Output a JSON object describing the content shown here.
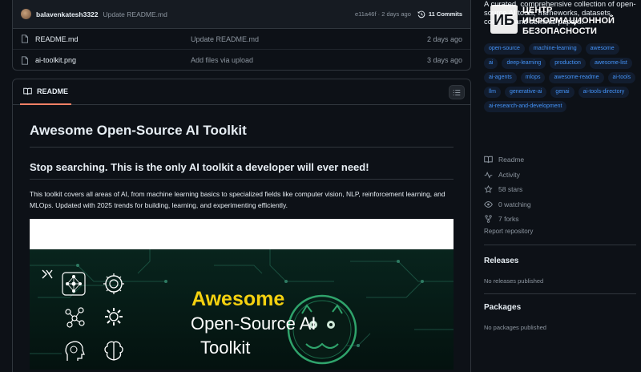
{
  "commit": {
    "user": "balavenkatesh3322",
    "message": "Update README.md",
    "hash_time": "e11a46f · 2 days ago",
    "commits_label": "11 Commits"
  },
  "files": [
    {
      "name": "README.md",
      "message": "Update README.md",
      "date": "2 days ago"
    },
    {
      "name": "ai-toolkit.png",
      "message": "Add files via upload",
      "date": "3 days ago"
    }
  ],
  "readme": {
    "tab_label": "README",
    "h1": "Awesome Open-Source AI Toolkit",
    "h2": "Stop searching. This is the only AI toolkit a developer will ever need!",
    "paragraph": "This toolkit covers all areas of AI, from machine learning basics to specialized fields like computer vision, NLP, reinforcement learning, and MLOps. Updated with 2025 trends for building, learning, and experimenting efficiently.",
    "banner": {
      "line1": "Awesome",
      "line2": "Open-Source AI",
      "line3": "Toolkit"
    }
  },
  "about": {
    "description": "A curated, comprehensive collection of open-source AI tools, frameworks, datasets, courses, and seminal papers."
  },
  "watermark": {
    "line1": "ЦЕНТР",
    "line2": "ИНФОРМАЦИОННОЙ",
    "line3": "БЕЗОПАСНОСТИ",
    "logo": "ИБ"
  },
  "topics": [
    "open-source",
    "machine-learning",
    "awesome",
    "ai",
    "deep-learning",
    "production",
    "awesome-list",
    "ai-agents",
    "mlops",
    "awesome-readme",
    "ai-tools",
    "llm",
    "generative-ai",
    "genai",
    "ai-tools-directory",
    "ai-research-and-development"
  ],
  "stats": {
    "readme": "Readme",
    "activity": "Activity",
    "stars": "58 stars",
    "watching": "0 watching",
    "forks": "7 forks",
    "report": "Report repository"
  },
  "releases": {
    "title": "Releases",
    "note": "No releases published"
  },
  "packages": {
    "title": "Packages",
    "note": "No packages published"
  },
  "colors": {
    "accent_link": "#4493f8",
    "tab_underline": "#f78166",
    "banner_title": "#f4d10f"
  }
}
